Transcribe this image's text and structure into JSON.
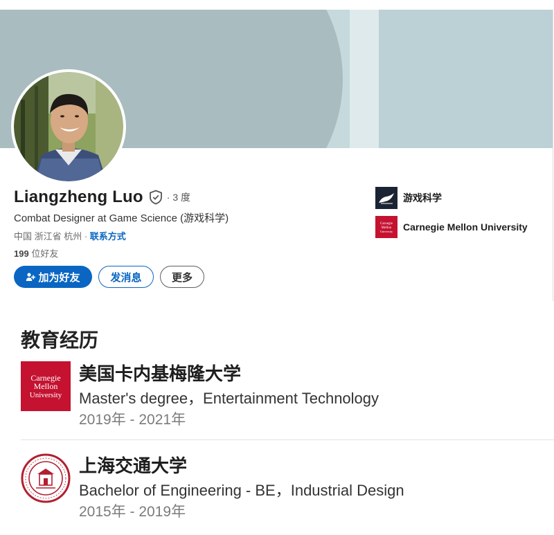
{
  "profile": {
    "name": "Liangzheng Luo",
    "connection_degree": "· 3 度",
    "headline": "Combat Designer at Game Science (游戏科学)",
    "location": "中国 浙江省 杭州 ·",
    "contact_label": "联系方式",
    "friends_count": "199",
    "friends_label": "位好友",
    "verified_icon": "shield-check-icon"
  },
  "actions": {
    "connect_label": "加为好友",
    "message_label": "发消息",
    "more_label": "更多"
  },
  "companies": [
    {
      "name": "游戏科学",
      "logo": "game-science-logo"
    },
    {
      "name": "Carnegie Mellon University",
      "logo": "cmu-logo"
    }
  ],
  "cmu_logo_text": [
    "Carnegie",
    "Mellon",
    "University"
  ],
  "education": {
    "title": "教育经历",
    "items": [
      {
        "school": "美国卡内基梅隆大学",
        "degree": "Master's degree，Entertainment Technology",
        "dates": "2019年 - 2021年",
        "logo": "cmu-logo"
      },
      {
        "school": "上海交通大学",
        "degree": "Bachelor of Engineering - BE，Industrial Design",
        "dates": "2015年 - 2019年",
        "logo": "sjtu-seal-logo"
      }
    ]
  },
  "colors": {
    "accent": "#0a66c2",
    "cmu_red": "#c41230",
    "sjtu_red": "#b31f30",
    "banner": "#a9bcbf"
  }
}
